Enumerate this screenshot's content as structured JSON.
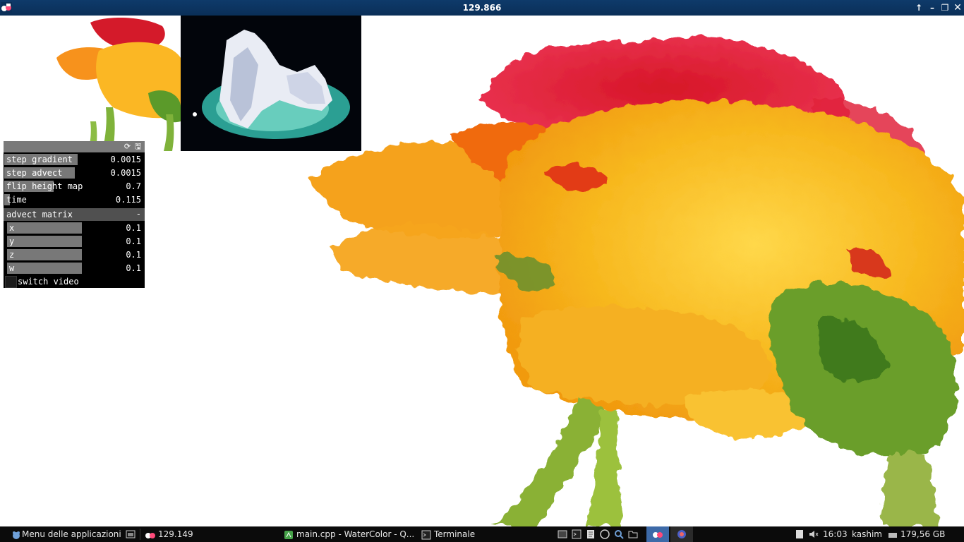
{
  "window": {
    "title": "129.866"
  },
  "panel": {
    "sliders": [
      {
        "label": "step gradient",
        "value": "0.0015",
        "level": 0.52
      },
      {
        "label": "step advect",
        "value": "0.0015",
        "level": 0.5
      },
      {
        "label": "flip height map",
        "value": "0.7",
        "level": 0.35
      },
      {
        "label": "time",
        "value": "0.115",
        "level": 0.04
      }
    ],
    "group": {
      "title": "advect matrix",
      "minimize": "-",
      "items": [
        {
          "label": "x",
          "value": "0.1",
          "level": 0.55
        },
        {
          "label": "y",
          "value": "0.1",
          "level": 0.55
        },
        {
          "label": "z",
          "value": "0.1",
          "level": 0.55
        },
        {
          "label": "w",
          "value": "0.1",
          "level": 0.55
        }
      ]
    },
    "toggle": {
      "label": "switch video",
      "checked": false
    }
  },
  "taskbar": {
    "menu_label": "Menu delle applicazioni",
    "tasks": [
      {
        "label": "129.149"
      },
      {
        "label": "main.cpp - WaterColor - Q..."
      },
      {
        "label": "Terminale"
      }
    ],
    "clock": "16:03",
    "user": "kashim",
    "disk": "179,56 GB"
  },
  "colors": {
    "titlebar": "#0a2f58",
    "panel_header": "#7a7a7a",
    "slider_fill": "#787878",
    "taskbar": "#0b0b0b"
  }
}
